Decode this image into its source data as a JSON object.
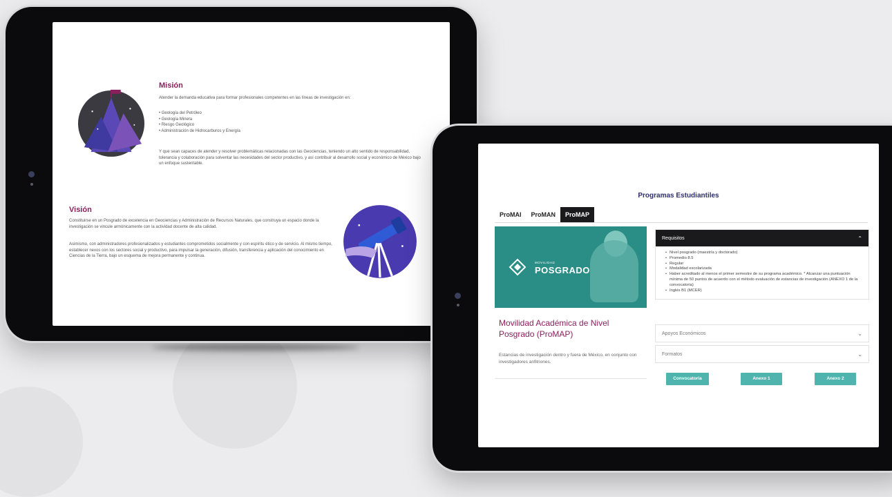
{
  "tablet1": {
    "mission": {
      "title": "Misión",
      "intro": "Atender la demanda educativa para formar profesionales competentes en las líneas de investigación en:",
      "lines": [
        "• Geología del Petróleo",
        "• Geología Minera",
        "• Riesgo Geológico",
        "• Administración de Hidrocarburos y Energía"
      ],
      "closing": "Y que sean capaces de atender y resolver problemáticas relacionadas con las Geociencias, teniendo un alto sentido de responsabilidad, tolerancia y colaboración para solventar las necesidades del sector productivo, y así contribuir al desarrollo social y económico de México bajo un enfoque sustentable."
    },
    "vision": {
      "title": "Visión",
      "p1": "Constituirse en un Posgrado de excelencia en Geociencias y Administración de Recursos Naturales, que construya un espacio donde la investigación se vincule armónicamente con la actividad docente de alta calidad.",
      "p2": "Asimismo, con administradores profesionalizados y estudiantes comprometidos socialmente y con espíritu ético y de servicio. Al mismo tiempo, establecer nexos con los sectores social y productivo, para impulsar la generación, difusión, transferencia y aplicación del conocimiento en Ciencias de la Tierra, bajo un esquema de mejora permanente y continua."
    }
  },
  "tablet2": {
    "page_title": "Programas Estudiantiles",
    "tabs": [
      "ProMAI",
      "ProMAN",
      "ProMAP"
    ],
    "active_tab": "ProMAP",
    "hero": {
      "brand_small": "MOVILIDAD",
      "brand_big": "POSGRADO"
    },
    "card_title": "Movilidad Académica de Nivel Posgrado (ProMAP)",
    "card_desc": "Estancias de investigación dentro y fuera de México, en conjunto con investigadores anfitriones.",
    "accordion": {
      "requisitos": {
        "label": "Requisitos",
        "items": [
          "Nivel posgrado (maestría y doctorado)",
          "Promedio 8.5",
          "Regular",
          "Modalidad escolarizada",
          "Haber acreditado al menos el primer semestre de su programa académico. * Alcanzar una puntuación mínima de 50 puntos de acuerdo con el método evaluación de estancias de investigación (ANEXO 1 de la convocatoria)",
          "Inglés B1 (MCER)"
        ]
      },
      "apoyos": {
        "label": "Apoyos Económicos"
      },
      "formatos": {
        "label": "Formatos"
      }
    },
    "buttons": {
      "convocatoria": "Convocatoria",
      "anexo1": "Anexo 1",
      "anexo2": "Anexo 2"
    }
  },
  "colors": {
    "accent_magenta": "#8a1f5d",
    "title_navy": "#2e2e6a",
    "button_teal": "#4fb3ae",
    "dark": "#1a1a1c"
  }
}
